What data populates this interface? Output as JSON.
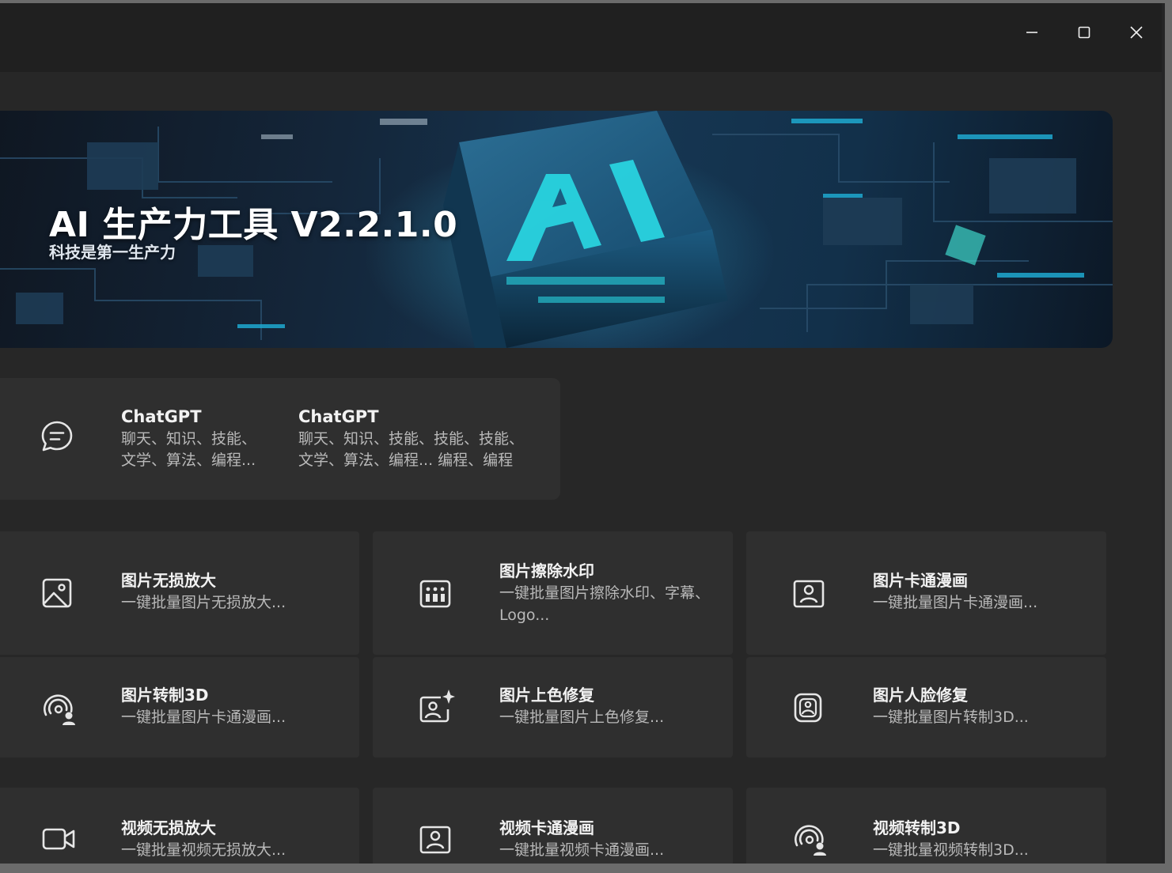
{
  "window": {
    "controls": {
      "minimize": "minimize-icon",
      "maximize": "maximize-icon",
      "close": "close-icon"
    }
  },
  "banner": {
    "title": "AI 生产力工具 V2.2.1.0",
    "subtitle": "科技是第一生产力",
    "accent_color": "#28c8d8"
  },
  "chat": {
    "icon": "chat-bubble-icon",
    "items": [
      {
        "title": "ChatGPT",
        "line1": "聊天、知识、技能、",
        "line2": "文学、算法、编程..."
      },
      {
        "title": "ChatGPT",
        "line1": "聊天、知识、技能、技能、技能、",
        "line2": "文学、算法、编程... 编程、编程"
      }
    ]
  },
  "tools": [
    {
      "icon": "image-icon",
      "title": "图片无损放大",
      "desc": "一键批量图片无损放大..."
    },
    {
      "icon": "watermark-erase-icon",
      "title": "图片擦除水印",
      "desc": "一键批量图片擦除水印、字幕、Logo..."
    },
    {
      "icon": "portrait-frame-icon",
      "title": "图片卡通漫画",
      "desc": "一键批量图片卡通漫画..."
    },
    {
      "icon": "3d-person-icon",
      "title": "图片转制3D",
      "desc": "一键批量图片卡通漫画..."
    },
    {
      "icon": "colorize-sparkle-icon",
      "title": "图片上色修复",
      "desc": "一键批量图片上色修复..."
    },
    {
      "icon": "face-restore-icon",
      "title": "图片人脸修复",
      "desc": "一键批量图片转制3D..."
    },
    {
      "icon": "video-camera-icon",
      "title": "视频无损放大",
      "desc": "一键批量视频无损放大..."
    },
    {
      "icon": "portrait-frame-icon",
      "title": "视频卡通漫画",
      "desc": "一键批量视频卡通漫画..."
    },
    {
      "icon": "3d-person-icon",
      "title": "视频转制3D",
      "desc": "一键批量视频转制3D..."
    }
  ]
}
